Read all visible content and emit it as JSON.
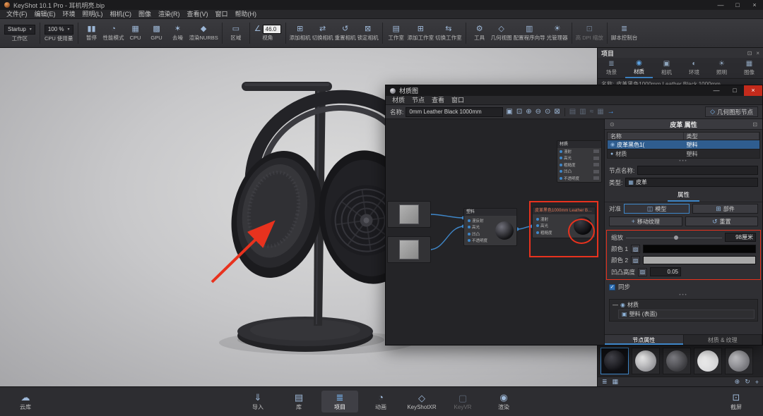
{
  "ui": {
    "grip_dots": "•••"
  },
  "annotations": {
    "color": "#e8321e"
  },
  "colors": {
    "accent_blue": "#3f87c9",
    "selection_blue": "#2f5d8f",
    "close_button_red": "#c42b1c",
    "panel_bg": "#2f2f33",
    "canvas_bg": "#242427"
  },
  "titlebar": {
    "title": "KeyShot 10.1 Pro - 耳机明亮.bip",
    "minimize_glyph": "—",
    "maximize_glyph": "□",
    "close_glyph": "×"
  },
  "menubar": {
    "items": [
      "文件(F)",
      "编辑(E)",
      "环境",
      "照明(L)",
      "相机(C)",
      "图像",
      "渲染(R)",
      "查看(V)",
      "窗口",
      "帮助(H)"
    ]
  },
  "toolbar": {
    "workspace": {
      "value": "Startup",
      "label": "工作区",
      "arrow": "▾"
    },
    "cpu_usage": {
      "value": "100 %",
      "label": "CPU 使用量",
      "arrow": "▾"
    },
    "view_angle": {
      "glyph": "∠",
      "value": "46.0",
      "label": "视角"
    },
    "buttons": [
      {
        "gly": "▮▮",
        "label": "暂停"
      },
      {
        "gly": "◔",
        "label": "性能模式"
      },
      {
        "gly": "▦",
        "label": "CPU"
      },
      {
        "gly": "▩",
        "label": "GPU"
      },
      {
        "gly": "✶",
        "label": "去噪"
      },
      {
        "gly": "◆",
        "label": "渲染NURBS"
      },
      {
        "gly": "▭",
        "label": "区域"
      },
      {
        "gly": "⊞",
        "label": "添加相机"
      },
      {
        "gly": "⇄",
        "label": "切换相机"
      },
      {
        "gly": "↺",
        "label": "重置相机"
      },
      {
        "gly": "⊠",
        "label": "锁定相机"
      },
      {
        "gly": "▤",
        "label": "工作室"
      },
      {
        "gly": "⊞",
        "label": "添加工作室"
      },
      {
        "gly": "⇆",
        "label": "切换工作室"
      },
      {
        "gly": "⚙",
        "label": "工具"
      },
      {
        "gly": "◇",
        "label": "几何视图"
      },
      {
        "gly": "▥",
        "label": "配置程序向导"
      },
      {
        "gly": "☀",
        "label": "光管理器"
      },
      {
        "gly": "⊡",
        "label": "高 DPI 缩放"
      },
      {
        "gly": "≣",
        "label": "脚本控制台"
      }
    ]
  },
  "project_panel": {
    "title": "项目",
    "float_glyph": "⊡",
    "close_glyph": "×",
    "tabs": [
      {
        "gly": "≣",
        "label": "场景"
      },
      {
        "gly": "◉",
        "label": "材质"
      },
      {
        "gly": "▣",
        "label": "相机"
      },
      {
        "gly": "◐",
        "label": "环境"
      },
      {
        "gly": "☀",
        "label": "照明"
      },
      {
        "gly": "▦",
        "label": "图像"
      }
    ],
    "name_row": {
      "label": "名称:",
      "value": "皮革黑色1000mm Leather Black 1000mm"
    },
    "preview_toolbar": {
      "list_glyph": "≣",
      "grid_glyph": "▦",
      "search_glyph": "⊕",
      "refresh_glyph": "↻",
      "add_glyph": "+"
    },
    "previews": [
      {
        "style": "background:radial-gradient(circle at 35% 30%, #4a4a52, #101014 72%)"
      },
      {
        "style": "background:radial-gradient(circle at 35% 30%, #ffffff, #9a9a9e 72%)"
      },
      {
        "style": "background:radial-gradient(circle at 35% 30%, #8a8a90, #3c3c40 72%)"
      },
      {
        "style": "background:radial-gradient(circle at 35% 30%, #ffffff, #d6d6d8 78%)"
      },
      {
        "style": "background:radial-gradient(circle at 35% 30%, #cfcfd3, #77777c 72%)"
      }
    ]
  },
  "material_graph": {
    "title": "材质图",
    "window_controls": {
      "minimize": "—",
      "maximize": "□",
      "close": "×"
    },
    "menu": [
      "材质",
      "节点",
      "查看",
      "窗口"
    ],
    "name_bar": {
      "label": "名称:",
      "value": "0mm Leather Black 1000mm",
      "icons": [
        {
          "gly": "▣"
        },
        {
          "gly": "⊡"
        },
        {
          "gly": "⊕"
        },
        {
          "gly": "⊖"
        },
        {
          "gly": "⊙"
        },
        {
          "gly": "⊠"
        },
        {
          "gly": "▤"
        },
        {
          "gly": "▥"
        },
        {
          "gly": "≈"
        },
        {
          "gly": "▦"
        }
      ],
      "apply_arrow_glyph": "→",
      "geometry_button": {
        "glyph": "◇",
        "label": "几何图形节点"
      }
    },
    "graph": {
      "overview_node": {
        "title": "材质",
        "ports": [
          "漫射",
          "高光",
          "粗糙度",
          "凹凸",
          "不透明度"
        ]
      },
      "plastic_node": {
        "title": "塑料",
        "ports": [
          "漫反射",
          "高光",
          "凹凸",
          "不透明度"
        ]
      },
      "material_node": {
        "title": "皮革黑色1000mm Leather B…",
        "ports": [
          "漫射",
          "高光",
          "粗糙度"
        ]
      }
    },
    "props": {
      "title": "皮革 属性",
      "pin_glyph": "⊙",
      "float_glyph": "⊡",
      "table": {
        "col_name": "名称",
        "col_type": "类型",
        "rows": [
          {
            "gly": "◉",
            "name": "皮革黑色1(",
            "type": "塑料"
          },
          {
            "gly": "●",
            "name": "材质",
            "type": "塑料"
          }
        ]
      },
      "node_name": {
        "label": "节点名称:",
        "value": ""
      },
      "type_row": {
        "label": "类型:",
        "gly": "▦",
        "value": "皮革"
      },
      "properties_tab": "属性",
      "align": {
        "label": "对准",
        "model": {
          "gly": "◫",
          "label": "模型"
        },
        "part": {
          "gly": "⊞",
          "label": "部件"
        }
      },
      "move_texture": {
        "gly": "+",
        "label": "移动纹理"
      },
      "reset": {
        "gly": "↺",
        "label": "重置"
      },
      "scale": {
        "label": "缩放",
        "value": "98厘米"
      },
      "color1": {
        "label": "颜色 1",
        "swatch_style": "background:#060606"
      },
      "color2": {
        "label": "颜色 2",
        "swatch_style": "background:#a8a8a8"
      },
      "bump": {
        "label": "凹凸高度",
        "gly": "▨",
        "value": "0.05"
      },
      "sync": {
        "label": "同步",
        "check_glyph": "✓"
      },
      "tree": {
        "root": {
          "expander": "—",
          "gly": "◉",
          "label": "材质"
        },
        "child": {
          "gly": "▣",
          "label": "塑料 (表面)"
        }
      },
      "bottom_tabs": [
        "节点属性",
        "材质 & 纹理"
      ]
    }
  },
  "dock": {
    "cloud": {
      "gly": "☁",
      "label": "云库"
    },
    "items": [
      {
        "gly": "⇓",
        "label": "导入"
      },
      {
        "gly": "▤",
        "label": "库"
      },
      {
        "gly": "≣",
        "label": "项目"
      },
      {
        "gly": "◔",
        "label": "动画"
      },
      {
        "gly": "◇",
        "label": "KeyShotXR"
      },
      {
        "gly": "▢",
        "label": "KeyVR"
      },
      {
        "gly": "◉",
        "label": "渲染"
      }
    ],
    "screenshot": {
      "gly": "⊡",
      "label": "截屏"
    }
  }
}
